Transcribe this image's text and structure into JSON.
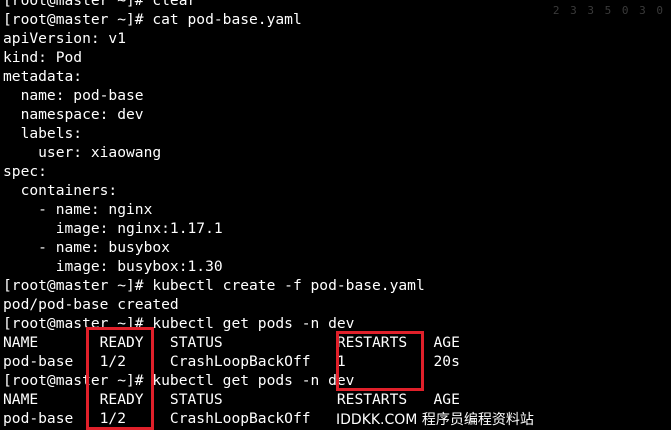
{
  "terminal": {
    "lines": [
      "[root@master ~]# clear",
      "[root@master ~]# cat pod-base.yaml",
      "apiVersion: v1",
      "kind: Pod",
      "metadata:",
      "  name: pod-base",
      "  namespace: dev",
      "  labels:",
      "    user: xiaowang",
      "spec:",
      "  containers:",
      "    - name: nginx",
      "      image: nginx:1.17.1",
      "    - name: busybox",
      "      image: busybox:1.30",
      "[root@master ~]# kubectl create -f pod-base.yaml",
      "pod/pod-base created",
      "[root@master ~]# kubectl get pods -n dev",
      "NAME       READY   STATUS             RESTARTS   AGE",
      "pod-base   1/2     CrashLoopBackOff   1          20s",
      "[root@master ~]# kubectl get pods -n dev",
      "NAME       READY   STATUS             RESTARTS   AGE",
      "pod-base   1/2     CrashLoopBackOff   "
    ]
  },
  "watermarks": {
    "top_right": "2 3 3 5 0 3 0",
    "footer": "IDDKK.COM 程序员编程资料站"
  },
  "colors": {
    "background": "#000000",
    "text": "#ffffff",
    "highlight": "#e0202a"
  }
}
